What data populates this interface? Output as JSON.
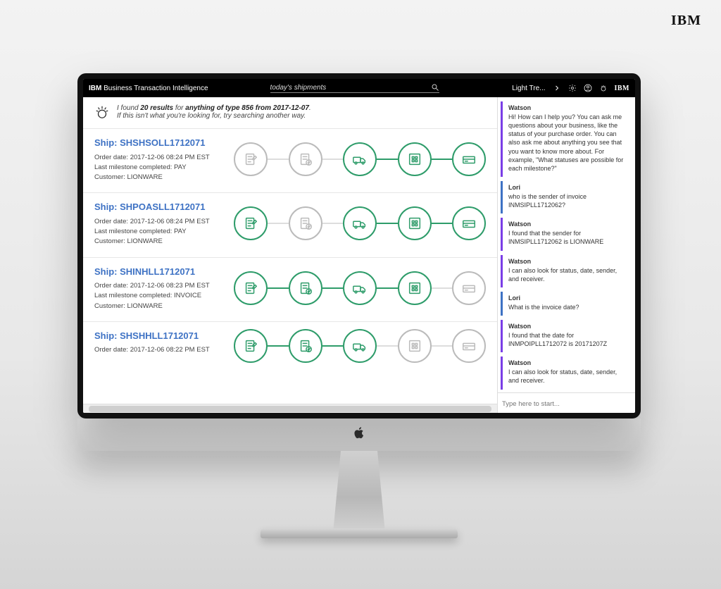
{
  "outer_logo": "IBM",
  "topbar": {
    "brand_prefix": "IBM",
    "brand_rest": " Business Transaction Intelligence",
    "search_value": "today's shipments",
    "theme_label": "Light Tre...",
    "ibm_small": "IBM"
  },
  "intro": {
    "line1_pre": "I found ",
    "line1_bold1": "20 results",
    "line1_mid": " for ",
    "line1_bold2": "anything of type 856 from 2017-12-07",
    "line1_post": ".",
    "line2": "If this isn't what you're looking for, try searching another way."
  },
  "results": [
    {
      "title": "Ship: SHSHSOLL1712071",
      "order_date": "Order date: 2017-12-06 08:24 PM EST",
      "milestone": "Last milestone completed: PAY",
      "customer": "Customer: LIONWARE",
      "stages": [
        "off",
        "off",
        "on",
        "on",
        "on"
      ]
    },
    {
      "title": "Ship: SHPOASLL1712071",
      "order_date": "Order date: 2017-12-06 08:24 PM EST",
      "milestone": "Last milestone completed: PAY",
      "customer": "Customer: LIONWARE",
      "stages": [
        "on",
        "off",
        "on",
        "on",
        "on"
      ]
    },
    {
      "title": "Ship: SHINHLL1712071",
      "order_date": "Order date: 2017-12-06 08:23 PM EST",
      "milestone": "Last milestone completed: INVOICE",
      "customer": "Customer: LIONWARE",
      "stages": [
        "on",
        "on",
        "on",
        "on",
        "off"
      ]
    },
    {
      "title": "Ship: SHSHHLL1712071",
      "order_date": "Order date: 2017-12-06 08:22 PM EST",
      "milestone": "",
      "customer": "",
      "stages": [
        "on",
        "on",
        "on",
        "off",
        "off"
      ]
    }
  ],
  "chat": {
    "messages": [
      {
        "who": "Watson",
        "role": "bot",
        "text": "Hi! How can I help you? You can ask me questions about your business, like the status of your purchase order. You can also ask me about anything you see that you want to know more about. For example, \"What statuses are possible for each milestone?\""
      },
      {
        "who": "Lori",
        "role": "user",
        "text": "who is the sender of invoice INMSIPLL1712062?"
      },
      {
        "who": "Watson",
        "role": "bot",
        "text": "I found that the sender for INMSIPLL1712062 is LIONWARE"
      },
      {
        "who": "Watson",
        "role": "bot",
        "text": "I can also look for status, date, sender, and receiver."
      },
      {
        "who": "Lori",
        "role": "user",
        "text": "What is the invoice date?"
      },
      {
        "who": "Watson",
        "role": "bot",
        "text": "I found that the date for INMPOIPLL1712072 is 20171207Z"
      },
      {
        "who": "Watson",
        "role": "bot",
        "text": "I can also look for status, date, sender, and receiver."
      }
    ],
    "input_placeholder": "Type here to start..."
  }
}
